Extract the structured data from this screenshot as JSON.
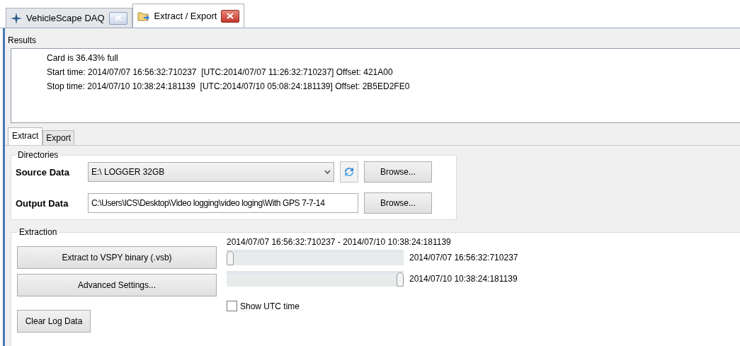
{
  "doc_tabs": [
    {
      "label": "VehicleScape DAQ",
      "selected": false,
      "kind": "star"
    },
    {
      "label": "Extract / Export",
      "selected": true,
      "kind": "folder"
    }
  ],
  "results": {
    "title": "Results",
    "lines": [
      "Card is 36.43% full",
      "Start time: 2014/07/07 16:56:32:710237  [UTC:2014/07/07 11:26:32:710237] Offset: 421A00",
      "Stop time: 2014/07/10 10:38:24:181139  [UTC:2014/07/10 05:08:24:181139] Offset: 2B5ED2FE0"
    ]
  },
  "tabs": [
    {
      "label": "Extract",
      "selected": true
    },
    {
      "label": "Export",
      "selected": false
    }
  ],
  "directories": {
    "title": "Directories",
    "source_label": "Source Data",
    "source_value": "E:\\ LOGGER 32GB",
    "source_browse": "Browse...",
    "output_label": "Output Data",
    "output_value": "C:\\Users\\ICS\\Desktop\\Video logging\\video loging\\With GPS 7-7-14",
    "output_browse": "Browse..."
  },
  "extraction": {
    "title": "Extraction",
    "extract_button": "Extract to VSPY binary (.vsb)",
    "advanced_button": "Advanced Settings...",
    "clear_button": "Clear Log Data",
    "range": "2014/07/07 16:56:32:710237 - 2014/07/10 10:38:24:181139",
    "sliders": [
      {
        "level": 0,
        "reading": "2014/07/07 16:56:32:710237"
      },
      {
        "level": 1,
        "reading": "2014/07/10 10:38:24:181139"
      }
    ],
    "utc": {
      "label": "Show UTC time",
      "checked": false
    }
  }
}
